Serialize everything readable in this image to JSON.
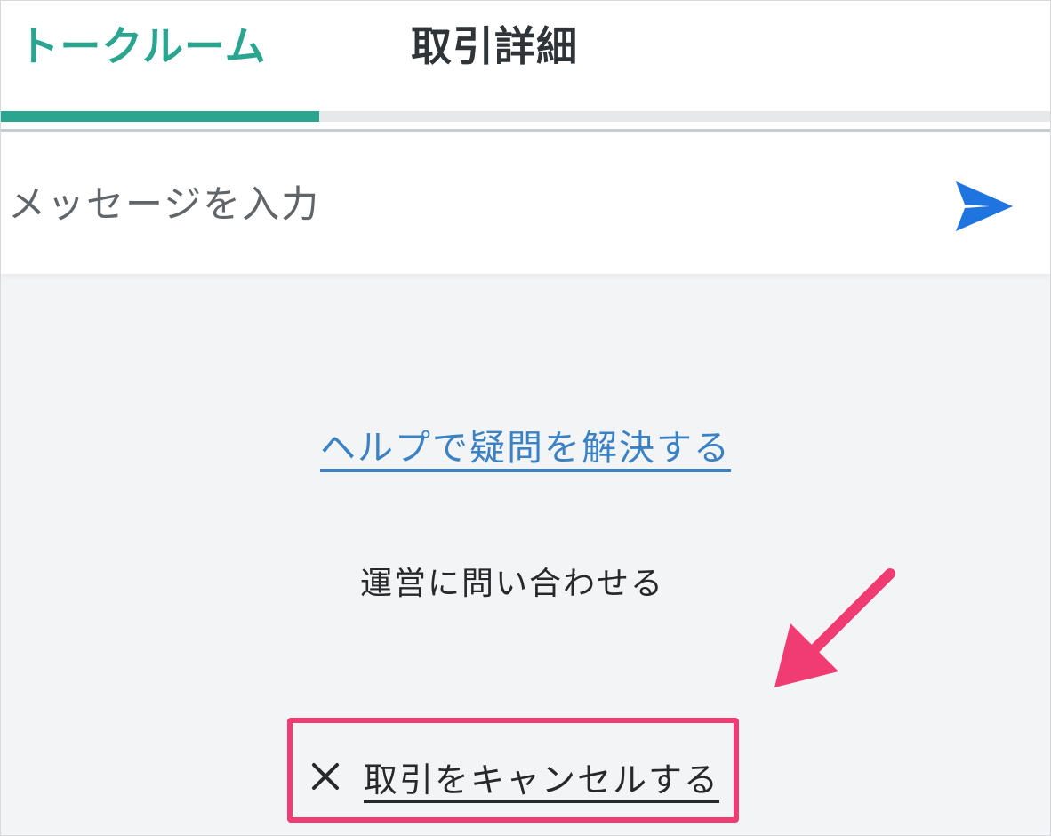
{
  "tabs": {
    "talk_room": "トークルーム",
    "detail": "取引詳細"
  },
  "message": {
    "placeholder": "メッセージを入力"
  },
  "links": {
    "help": "ヘルプで疑問を解決する",
    "contact": "運営に問い合わせる",
    "cancel": "取引をキャンセルする"
  },
  "icons": {
    "send": "send-arrow-icon",
    "cancel": "close-x-icon",
    "annotation": "pink-arrow-annotation"
  },
  "colors": {
    "accent": "#2aa58f",
    "link": "#3b82c4",
    "send": "#1f74e0",
    "highlight": "#f03c72"
  }
}
